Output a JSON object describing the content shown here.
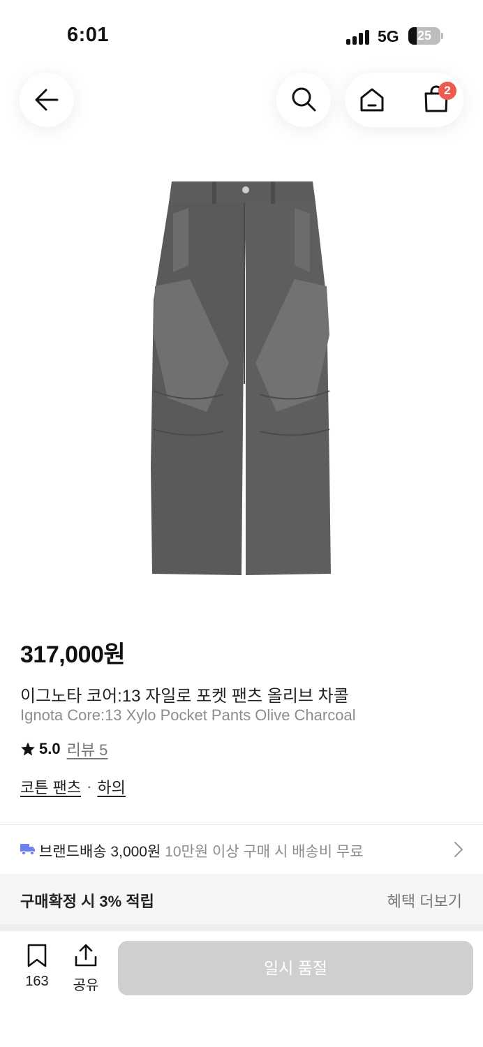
{
  "status_bar": {
    "time": "6:01",
    "network": "5G",
    "battery": "25",
    "battery_level": 0.25
  },
  "nav": {
    "back_icon": "arrow-left-icon",
    "search_icon": "search-icon",
    "home_icon": "home-icon",
    "cart_icon": "shopping-bag-icon",
    "cart_badge": "2"
  },
  "product": {
    "image_subject": "charcoal cargo pants",
    "price": "317,000원",
    "name_ko": "이그노타 코어:13 자일로 포켓 팬츠 올리브 차콜",
    "name_en": "Ignota Core:13 Xylo Pocket Pants Olive Charcoal",
    "rating": "5.0",
    "review_link": "리뷰 5",
    "categories": [
      "코튼 팬츠",
      "하의"
    ],
    "category_separator": "·"
  },
  "shipping": {
    "label": "브랜드배송 3,000원",
    "note": "10만원 이상 구매 시 배송비 무료"
  },
  "benefit": {
    "text": "구매확정 시 3% 적립",
    "more": "혜택 더보기"
  },
  "bottom_bar": {
    "bookmark_count": "163",
    "share_label": "공유",
    "soldout_label": "일시 품절"
  },
  "colors": {
    "badge": "#ef5a4f",
    "truck": "#6e7ff0",
    "button_disabled": "#cfcfcf",
    "pants": "#5f5f5f"
  }
}
